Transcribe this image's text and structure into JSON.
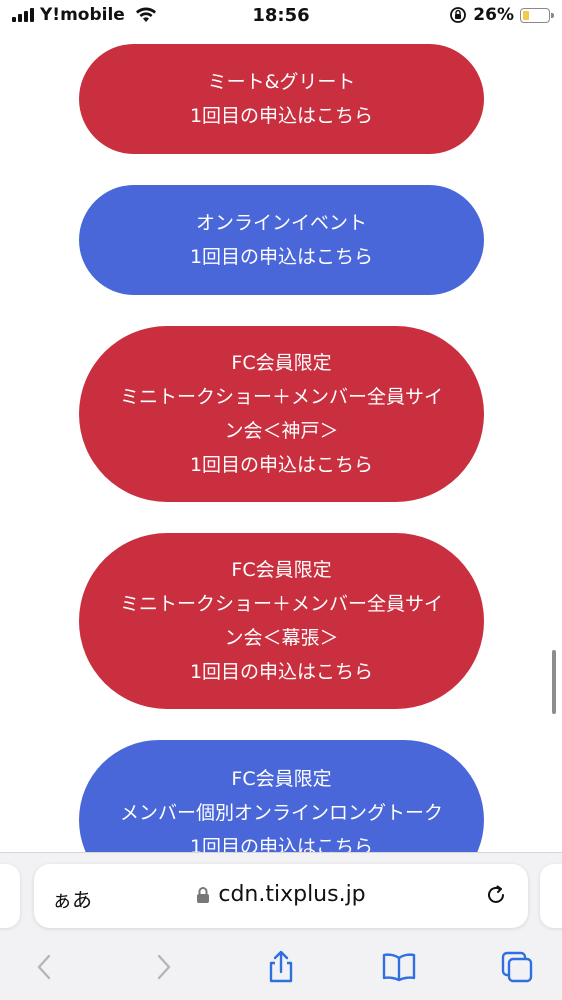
{
  "status_bar": {
    "carrier": "Y!mobile",
    "time": "18:56",
    "battery_percent": "26%",
    "battery_level": 0.26,
    "battery_color": "#f2c94c"
  },
  "buttons": [
    {
      "color": "red",
      "lines": [
        "ミート&グリート",
        "1回目の申込はこちら"
      ]
    },
    {
      "color": "blue",
      "lines": [
        "オンラインイベント",
        "1回目の申込はこちら"
      ]
    },
    {
      "color": "red",
      "lines": [
        "FC会員限定",
        "ミニトークショー＋メンバー全員サイ",
        "ン会＜神戸＞",
        "1回目の申込はこちら"
      ]
    },
    {
      "color": "red",
      "lines": [
        "FC会員限定",
        "ミニトークショー＋メンバー全員サイ",
        "ン会＜幕張＞",
        "1回目の申込はこちら"
      ]
    },
    {
      "color": "blue",
      "lines": [
        "FC会員限定",
        "メンバー個別オンラインロングトーク",
        "1回目の申込はこちら"
      ]
    }
  ],
  "colors": {
    "red": "#c92f3f",
    "blue": "#4967d9"
  },
  "address_bar": {
    "text_size_label": "ぁあ",
    "url": "cdn.tixplus.jp"
  },
  "icons": {
    "back": "chevron-left-icon",
    "forward": "chevron-right-icon",
    "share": "share-icon",
    "bookmarks": "book-icon",
    "tabs": "tabs-icon",
    "reload": "reload-icon",
    "lock": "lock-icon"
  }
}
